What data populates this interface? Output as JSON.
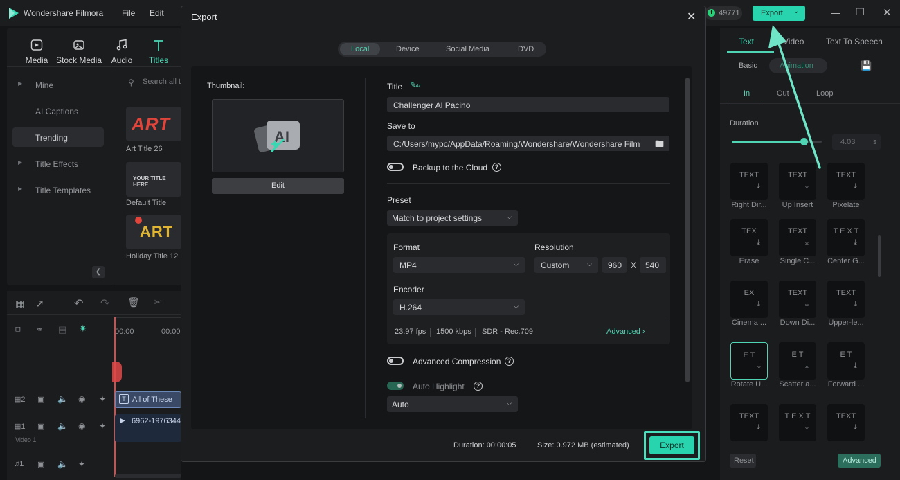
{
  "app": {
    "title": "Wondershare Filmora",
    "menu": [
      "File",
      "Edit"
    ],
    "credits": "49771",
    "top_export_label": "Export"
  },
  "toolbar": {
    "items": [
      {
        "label": "Media",
        "icon": "media-icon"
      },
      {
        "label": "Stock Media",
        "icon": "stock-media-icon"
      },
      {
        "label": "Audio",
        "icon": "audio-icon"
      },
      {
        "label": "Titles",
        "icon": "titles-icon"
      }
    ]
  },
  "sidebar": {
    "items": [
      {
        "label": "Mine",
        "active": false
      },
      {
        "label": "AI Captions",
        "active": false
      },
      {
        "label": "Trending",
        "active": true
      },
      {
        "label": "Title Effects",
        "active": false
      },
      {
        "label": "Title Templates",
        "active": false
      }
    ],
    "search_placeholder": "Search all t"
  },
  "library": {
    "items": [
      {
        "label": "Art Title 26",
        "thumb_text": "ART"
      },
      {
        "label": "Default Title",
        "thumb_text": "YOUR TITLE HERE"
      },
      {
        "label": "Holiday Title 12",
        "thumb_text": "ART"
      }
    ]
  },
  "timeline": {
    "ruler": [
      "00:00",
      "00:00"
    ],
    "tracks": [
      {
        "number": "2",
        "clip": "All of These"
      },
      {
        "number": "1",
        "name": "Video 1",
        "clip": "6962-1976344"
      }
    ]
  },
  "right_panel": {
    "tabs": [
      "Text",
      "Video",
      "Text To Speech"
    ],
    "subtabs": [
      "Basic",
      "Animation"
    ],
    "anim_tabs": [
      "In",
      "Out",
      "Loop"
    ],
    "duration_label": "Duration",
    "duration_value": "4.03",
    "duration_unit": "s",
    "duration_fraction": 0.8,
    "effects": [
      {
        "preview": "TEXT",
        "label": "Right Dir..."
      },
      {
        "preview": "TEXT",
        "label": "Up Insert"
      },
      {
        "preview": "TEXT",
        "label": "Pixelate"
      },
      {
        "preview": "TEX",
        "label": "Erase"
      },
      {
        "preview": "TEXT",
        "label": "Single C..."
      },
      {
        "preview": "T E X T",
        "label": "Center G..."
      },
      {
        "preview": "EX",
        "label": "Cinema ..."
      },
      {
        "preview": "TEXT",
        "label": "Down Di..."
      },
      {
        "preview": "TEXT",
        "label": "Upper-le..."
      },
      {
        "preview": "E T",
        "label": "Rotate U..."
      },
      {
        "preview": "E T",
        "label": "Scatter a..."
      },
      {
        "preview": "E T",
        "label": "Forward ..."
      },
      {
        "preview": "TEXT",
        "label": ""
      },
      {
        "preview": "T E X T",
        "label": ""
      },
      {
        "preview": "TEXT",
        "label": ""
      }
    ],
    "reset_label": "Reset",
    "advanced_label": "Advanced"
  },
  "export_dialog": {
    "title": "Export",
    "tabs": [
      "Local",
      "Device",
      "Social Media",
      "DVD"
    ],
    "active_tab": "Local",
    "thumbnail_label": "Thumbnail:",
    "edit_label": "Edit",
    "title_label": "Title",
    "title_value": "Challenger Al Pacino",
    "save_to_label": "Save to",
    "save_to_value": "C:/Users/mypc/AppData/Roaming/Wondershare/Wondershare Film",
    "backup_label": "Backup to the Cloud",
    "preset_label": "Preset",
    "preset_value": "Match to project settings",
    "format_label": "Format",
    "format_value": "MP4",
    "resolution_label": "Resolution",
    "resolution_value": "Custom",
    "width": "960",
    "x_label": "X",
    "height": "540",
    "encoder_label": "Encoder",
    "encoder_value": "H.264",
    "fps": "23.97 fps",
    "bitrate": "1500 kbps",
    "color": "SDR - Rec.709",
    "advanced_link": "Advanced",
    "advanced_compression_label": "Advanced Compression",
    "auto_highlight_label": "Auto Highlight",
    "auto_value": "Auto",
    "duration_text": "Duration:  00:00:05",
    "size_text": "Size:  0.972 MB (estimated)",
    "export_button": "Export"
  }
}
